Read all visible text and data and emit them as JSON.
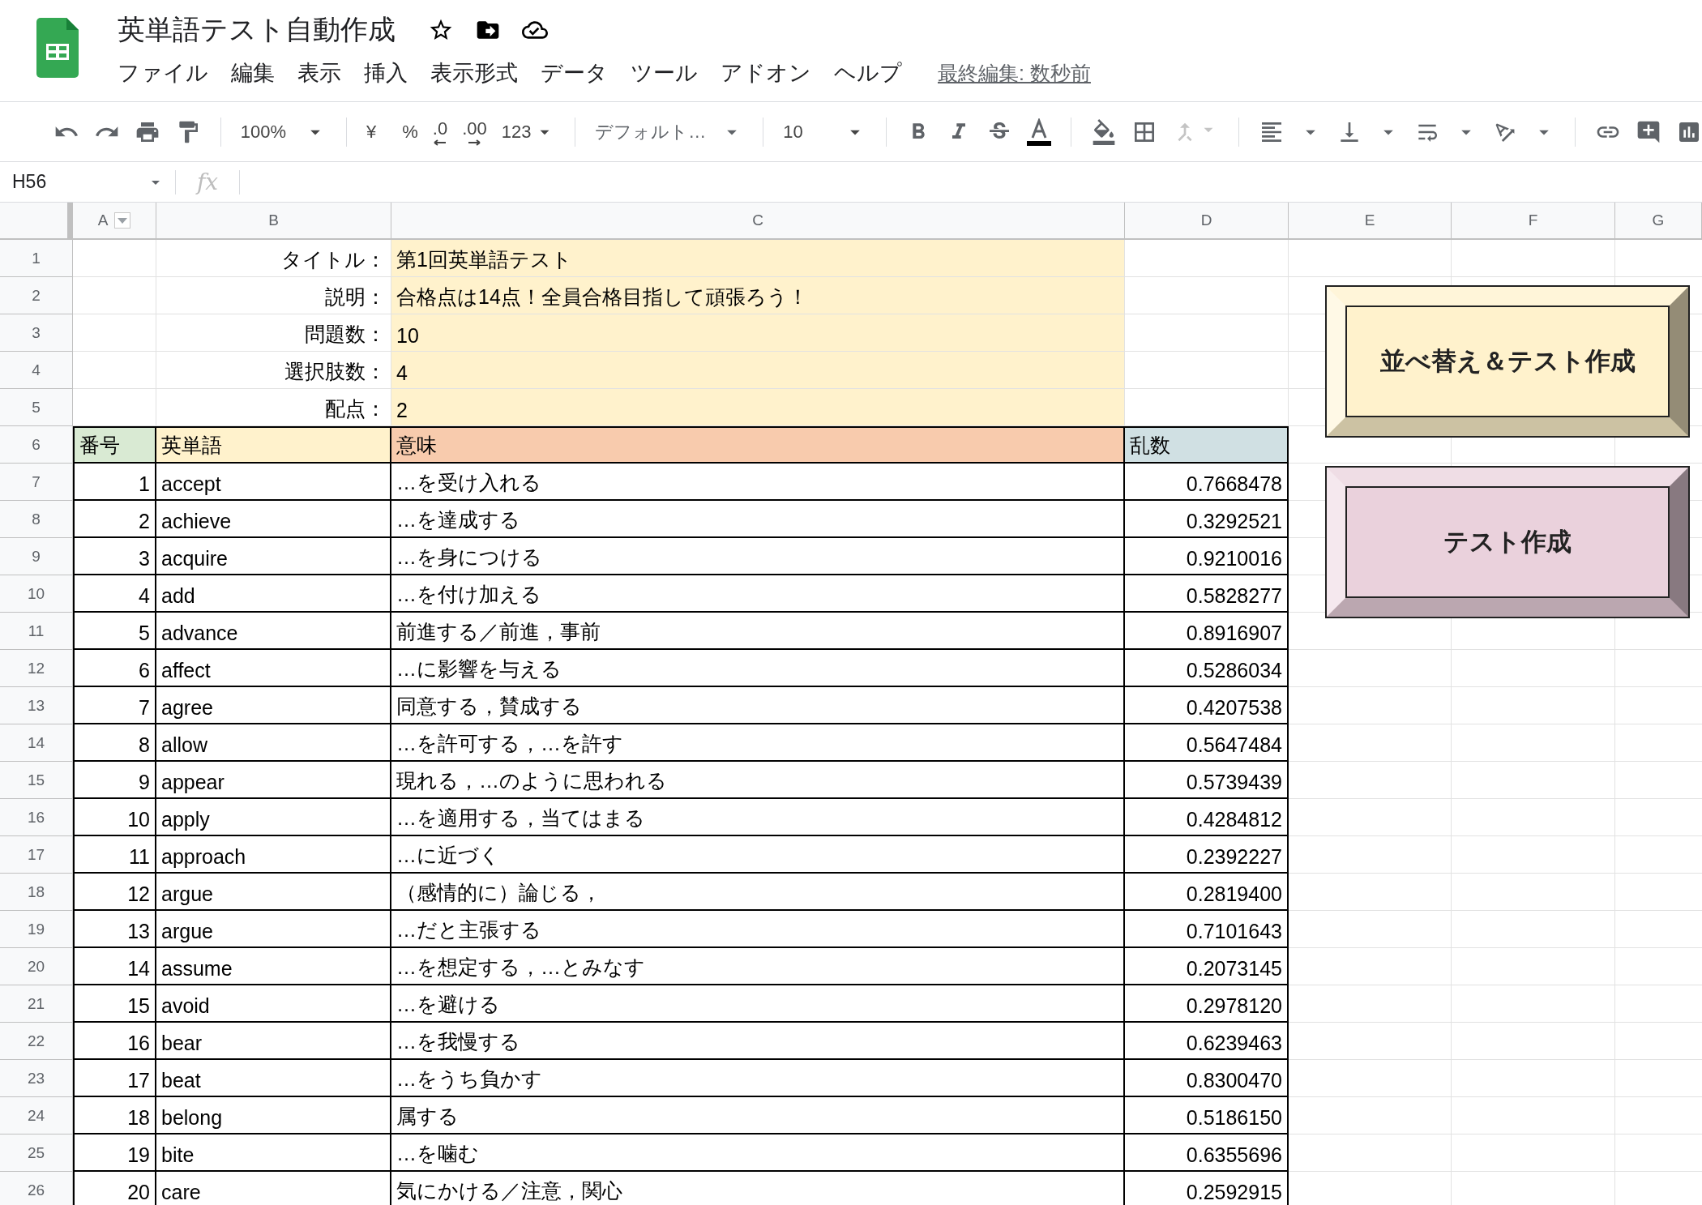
{
  "app": {
    "title": "英単語テスト自動作成",
    "menu": [
      "ファイル",
      "編集",
      "表示",
      "挿入",
      "表示形式",
      "データ",
      "ツール",
      "アドオン",
      "ヘルプ"
    ],
    "last_edit": "最終編集: 数秒前"
  },
  "toolbar": {
    "zoom": "100%",
    "currency": "¥",
    "percent": "%",
    "decrease_decimal": ".0",
    "increase_decimal": ".00",
    "number_format": "123",
    "font": "デフォルト…",
    "font_size": "10"
  },
  "formula_bar": {
    "cell_ref": "H56",
    "fx": "fx"
  },
  "columns": [
    "A",
    "B",
    "C",
    "D",
    "E",
    "F",
    "G"
  ],
  "row_numbers": [
    "1",
    "2",
    "3",
    "4",
    "5",
    "6",
    "7",
    "8",
    "9",
    "10",
    "11",
    "12",
    "13",
    "14",
    "15",
    "16",
    "17",
    "18",
    "19",
    "20",
    "21",
    "22",
    "23",
    "24",
    "25",
    "26"
  ],
  "info_rows": [
    {
      "label": "タイトル：",
      "value": "第1回英単語テスト"
    },
    {
      "label": "説明：",
      "value": "合格点は14点！全員合格目指して頑張ろう！"
    },
    {
      "label": "問題数：",
      "value": "10"
    },
    {
      "label": "選択肢数：",
      "value": "4"
    },
    {
      "label": "配点：",
      "value": "2"
    }
  ],
  "table": {
    "headers": [
      {
        "label": "番号",
        "color": "#d9ead3"
      },
      {
        "label": "英単語",
        "color": "#fff2cc"
      },
      {
        "label": "意味",
        "color": "#f8cbad"
      },
      {
        "label": "乱数",
        "color": "#d0e0e3"
      }
    ],
    "rows": [
      {
        "number": "1",
        "word": "accept",
        "meaning": "…を受け入れる",
        "random": "0.7668478"
      },
      {
        "number": "2",
        "word": "achieve",
        "meaning": "…を達成する",
        "random": "0.3292521"
      },
      {
        "number": "3",
        "word": "acquire",
        "meaning": "…を身につける",
        "random": "0.9210016"
      },
      {
        "number": "4",
        "word": "add",
        "meaning": "…を付け加える",
        "random": "0.5828277"
      },
      {
        "number": "5",
        "word": "advance",
        "meaning": "前進する／前進，事前",
        "random": "0.8916907"
      },
      {
        "number": "6",
        "word": "affect",
        "meaning": "…に影響を与える",
        "random": "0.5286034"
      },
      {
        "number": "7",
        "word": "agree",
        "meaning": "同意する，賛成する",
        "random": "0.4207538"
      },
      {
        "number": "8",
        "word": "allow",
        "meaning": "…を許可する，…を許す",
        "random": "0.5647484"
      },
      {
        "number": "9",
        "word": "appear",
        "meaning": "現れる，…のように思われる",
        "random": "0.5739439"
      },
      {
        "number": "10",
        "word": "apply",
        "meaning": "…を適用する，当てはまる",
        "random": "0.4284812"
      },
      {
        "number": "11",
        "word": "approach",
        "meaning": "…に近づく",
        "random": "0.2392227"
      },
      {
        "number": "12",
        "word": "argue",
        "meaning": "（感情的に）論じる，",
        "random": "0.2819400"
      },
      {
        "number": "13",
        "word": "argue",
        "meaning": "…だと主張する",
        "random": "0.7101643"
      },
      {
        "number": "14",
        "word": "assume",
        "meaning": "…を想定する，…とみなす",
        "random": "0.2073145"
      },
      {
        "number": "15",
        "word": "avoid",
        "meaning": "…を避ける",
        "random": "0.2978120"
      },
      {
        "number": "16",
        "word": "bear",
        "meaning": "…を我慢する",
        "random": "0.6239463"
      },
      {
        "number": "17",
        "word": "beat",
        "meaning": "…をうち負かす",
        "random": "0.8300470"
      },
      {
        "number": "18",
        "word": "belong",
        "meaning": "属する",
        "random": "0.5186150"
      },
      {
        "number": "19",
        "word": "bite",
        "meaning": "…を噛む",
        "random": "0.6355696"
      },
      {
        "number": "20",
        "word": "care",
        "meaning": "気にかける／注意，関心",
        "random": "0.2592915"
      }
    ]
  },
  "buttons": [
    {
      "label": "並べ替え＆テスト作成",
      "color": "#fff2cc"
    },
    {
      "label": "テスト作成",
      "color": "#ead1dc"
    }
  ]
}
